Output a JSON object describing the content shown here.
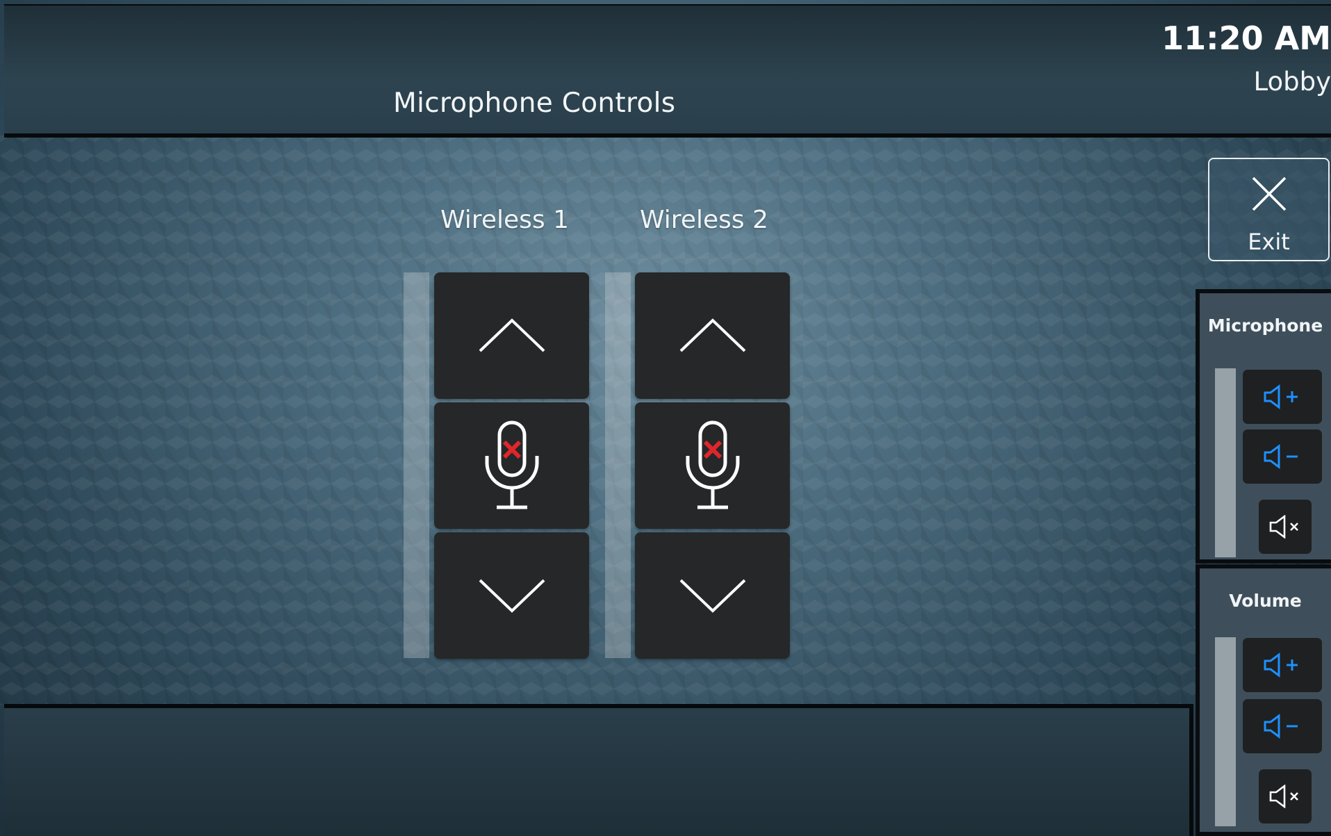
{
  "header": {
    "title": "Microphone Controls",
    "clock": "11:20 AM",
    "room": "Lobby"
  },
  "channels": [
    {
      "label": "Wireless 1",
      "muted": true,
      "level": 0
    },
    {
      "label": "Wireless 2",
      "muted": true,
      "level": 0
    }
  ],
  "exit": {
    "label": "Exit"
  },
  "side_panels": {
    "microphone": {
      "title": "Microphone",
      "level": 0
    },
    "volume": {
      "title": "Volume",
      "level": 0
    }
  },
  "colors": {
    "accent_blue": "#1e90ff",
    "mute_red": "#e0262b",
    "button_bg": "#262728",
    "meter_fill": "#8fd14f"
  }
}
